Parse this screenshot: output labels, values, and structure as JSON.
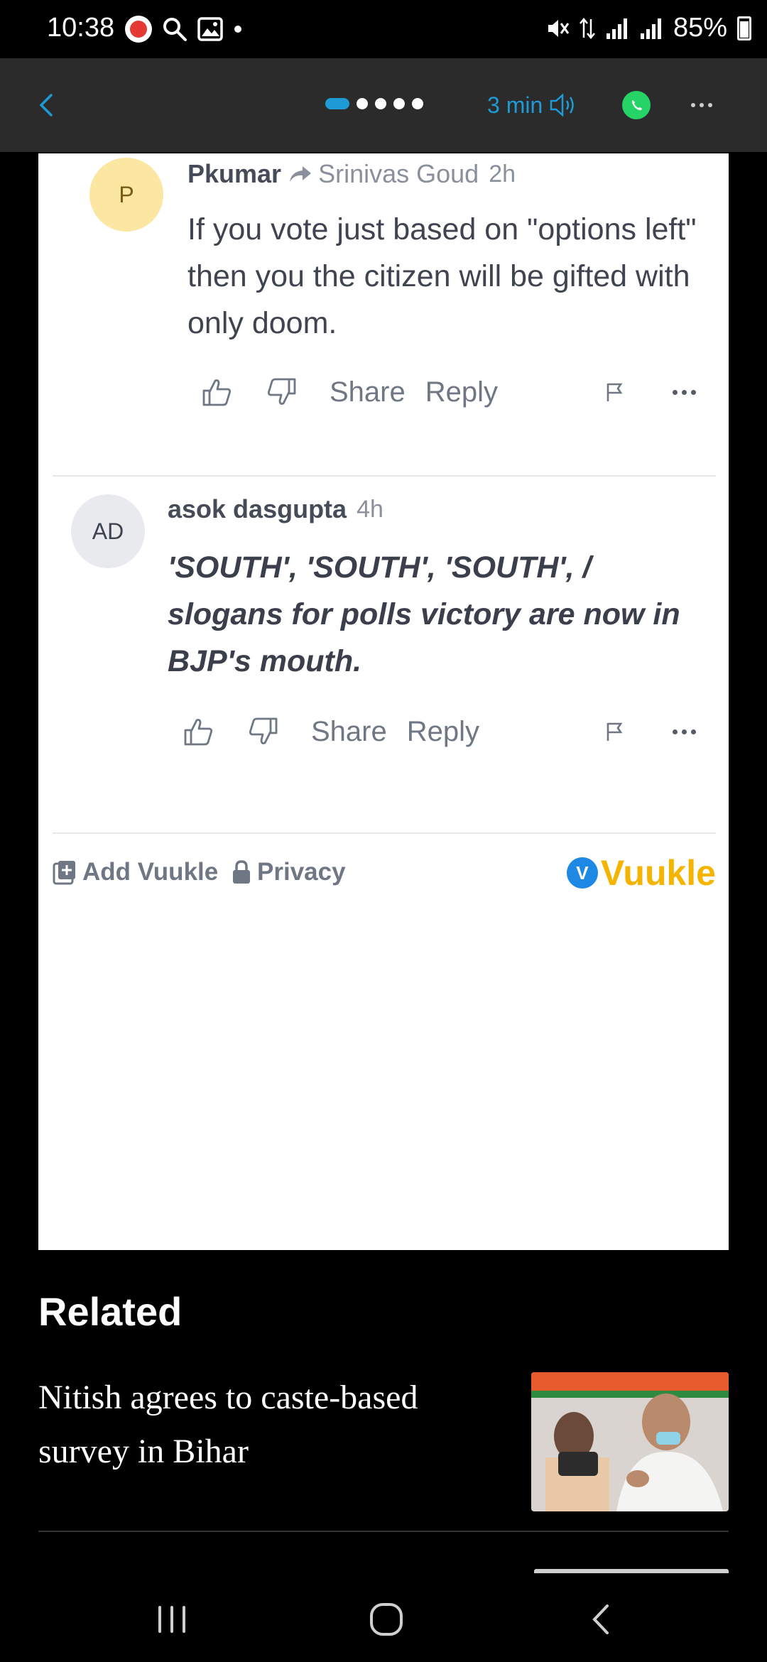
{
  "status_bar": {
    "time": "10:38",
    "battery": "85%",
    "icons": [
      "app-notification-icon",
      "search-icon",
      "image-icon",
      "dot-icon",
      "mute-icon",
      "data-arrows-icon",
      "signal-icon",
      "signal-icon",
      "battery-icon"
    ]
  },
  "toolbar": {
    "read_time": "3 min",
    "page_dots_total": 5,
    "page_dots_active": 1,
    "accent_color": "#1e9bd7",
    "whatsapp_color": "#25d366"
  },
  "comments": [
    {
      "avatar": "P",
      "author": "Pkumar",
      "reply_to": "Srinivas Goud",
      "time": "2h",
      "text": "If you vote just based on \"options left\" then you the citizen will be gifted with only doom.",
      "share": "Share",
      "reply": "Reply"
    },
    {
      "avatar": "AD",
      "author": "asok dasgupta",
      "time": "4h",
      "text": "'SOUTH', 'SOUTH', 'SOUTH', / slogans for polls victory are now in BJP's mouth.",
      "share": "Share",
      "reply": "Reply"
    }
  ],
  "vuukle_footer": {
    "add_vuukle": "Add Vuukle",
    "privacy": "Privacy",
    "brand": "Vuukle",
    "brand_badge": "V",
    "brand_color": "#f4b400"
  },
  "related": {
    "title": "Related",
    "items": [
      {
        "headline": "Nitish agrees to caste-based survey in Bihar"
      }
    ]
  }
}
